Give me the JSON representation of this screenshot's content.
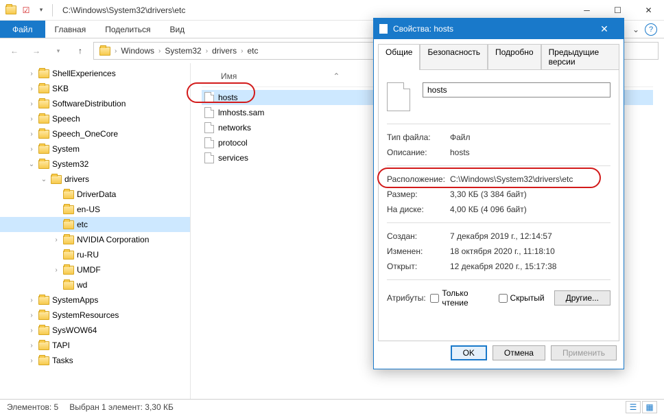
{
  "titlebar": {
    "path": "C:\\Windows\\System32\\drivers\\etc"
  },
  "ribbon": {
    "file": "Файл",
    "home": "Главная",
    "share": "Поделиться",
    "view": "Вид"
  },
  "breadcrumbs": [
    "Windows",
    "System32",
    "drivers",
    "etc"
  ],
  "tree": [
    {
      "label": "ShellExperiences",
      "indent": 40,
      "exp": ">"
    },
    {
      "label": "SKB",
      "indent": 40,
      "exp": ">"
    },
    {
      "label": "SoftwareDistribution",
      "indent": 40,
      "exp": ">"
    },
    {
      "label": "Speech",
      "indent": 40,
      "exp": ">"
    },
    {
      "label": "Speech_OneCore",
      "indent": 40,
      "exp": ">"
    },
    {
      "label": "System",
      "indent": 40,
      "exp": ">"
    },
    {
      "label": "System32",
      "indent": 40,
      "exp": "v"
    },
    {
      "label": "drivers",
      "indent": 58,
      "exp": "v"
    },
    {
      "label": "DriverData",
      "indent": 76,
      "exp": ""
    },
    {
      "label": "en-US",
      "indent": 76,
      "exp": ""
    },
    {
      "label": "etc",
      "indent": 76,
      "exp": "",
      "sel": true
    },
    {
      "label": "NVIDIA Corporation",
      "indent": 76,
      "exp": ">"
    },
    {
      "label": "ru-RU",
      "indent": 76,
      "exp": ""
    },
    {
      "label": "UMDF",
      "indent": 76,
      "exp": ">"
    },
    {
      "label": "wd",
      "indent": 76,
      "exp": ""
    },
    {
      "label": "SystemApps",
      "indent": 40,
      "exp": ">"
    },
    {
      "label": "SystemResources",
      "indent": 40,
      "exp": ">"
    },
    {
      "label": "SysWOW64",
      "indent": 40,
      "exp": ">"
    },
    {
      "label": "TAPI",
      "indent": 40,
      "exp": ">"
    },
    {
      "label": "Tasks",
      "indent": 40,
      "exp": ">"
    }
  ],
  "filepane": {
    "col_name": "Имя",
    "files": [
      {
        "name": "hosts",
        "sel": true
      },
      {
        "name": "lmhosts.sam"
      },
      {
        "name": "networks"
      },
      {
        "name": "protocol"
      },
      {
        "name": "services"
      }
    ]
  },
  "statusbar": {
    "count": "Элементов: 5",
    "selection": "Выбран 1 элемент: 3,30 КБ"
  },
  "dialog": {
    "title": "Свойства: hosts",
    "tabs": {
      "general": "Общие",
      "security": "Безопасность",
      "details": "Подробно",
      "prev": "Предыдущие версии"
    },
    "name_value": "hosts",
    "labels": {
      "type": "Тип файла:",
      "desc": "Описание:",
      "loc": "Расположение:",
      "size": "Размер:",
      "ondisk": "На диске:",
      "created": "Создан:",
      "modified": "Изменен:",
      "opened": "Открыт:",
      "attr": "Атрибуты:",
      "readonly": "Только чтение",
      "hidden": "Скрытый",
      "other": "Другие..."
    },
    "values": {
      "type": "Файл",
      "desc": "hosts",
      "loc": "C:\\Windows\\System32\\drivers\\etc",
      "size": "3,30 КБ (3 384 байт)",
      "ondisk": "4,00 КБ (4 096 байт)",
      "created": "7 декабря 2019 г., 12:14:57",
      "modified": "18 октября 2020 г., 11:18:10",
      "opened": "12 декабря 2020 г., 15:17:38"
    },
    "buttons": {
      "ok": "OK",
      "cancel": "Отмена",
      "apply": "Применить"
    }
  }
}
